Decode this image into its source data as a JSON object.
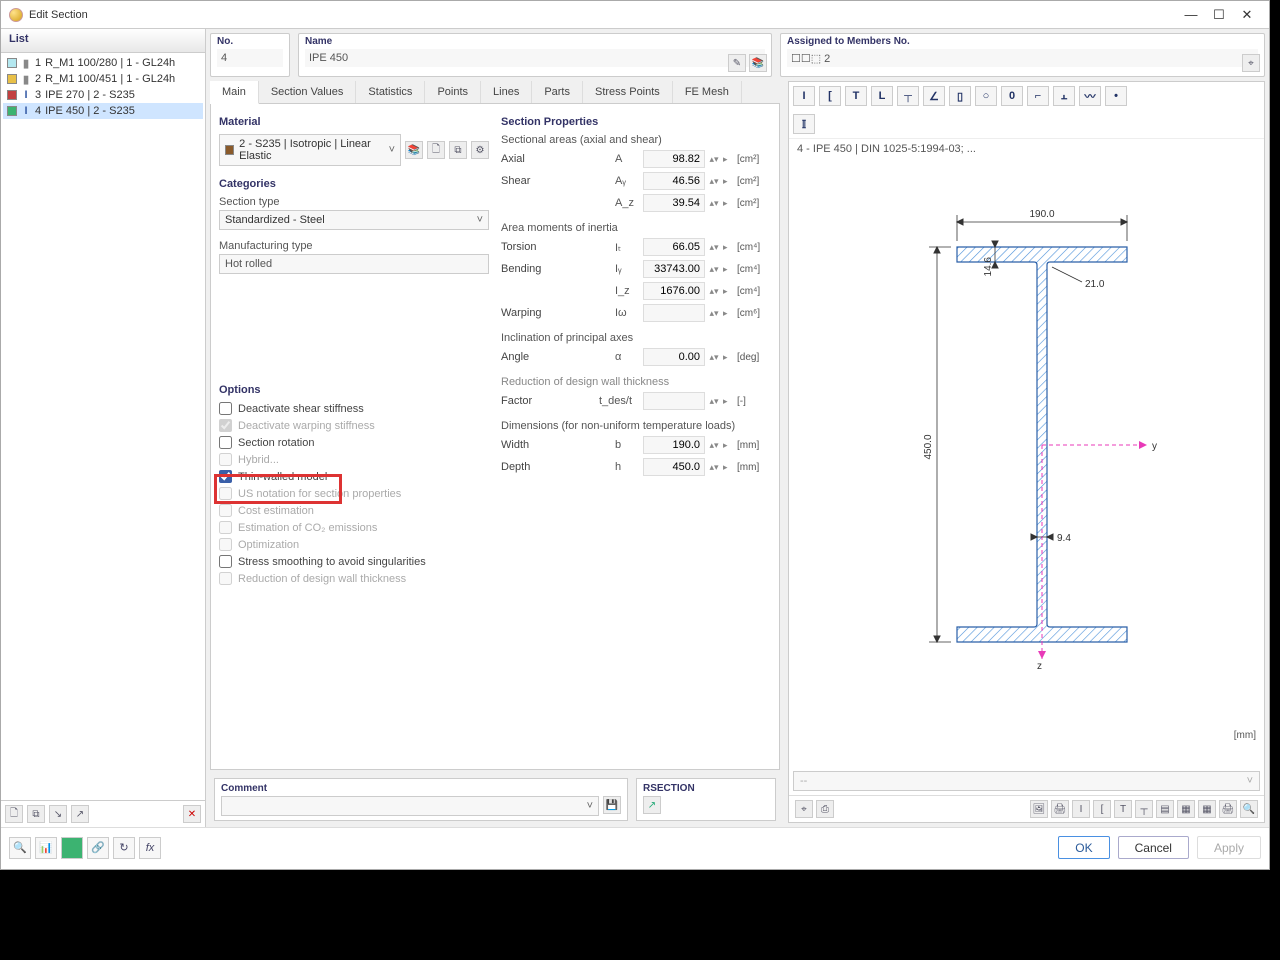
{
  "window_title": "Edit Section",
  "list_header": "List",
  "list_items": [
    {
      "num": "1",
      "text": "R_M1 100/280 | 1 - GL24h",
      "color": "#b4e8f0",
      "shape_color": "#888"
    },
    {
      "num": "2",
      "text": "R_M1 100/451 | 1 - GL24h",
      "color": "#e8c048",
      "shape_color": "#888"
    },
    {
      "num": "3",
      "text": "IPE 270 | 2 - S235",
      "color": "#c24040",
      "shape_color": "#3a5fa8"
    },
    {
      "num": "4",
      "text": "IPE 450 | 2 - S235",
      "color": "#3cb371",
      "shape_color": "#3a5fa8"
    }
  ],
  "no_label": "No.",
  "no_value": "4",
  "name_label": "Name",
  "name_value": "IPE 450",
  "assigned_label": "Assigned to Members No.",
  "assigned_value": "☐☐⬚ 2",
  "tabs": [
    "Main",
    "Section Values",
    "Statistics",
    "Points",
    "Lines",
    "Parts",
    "Stress Points",
    "FE Mesh"
  ],
  "material_header": "Material",
  "material_value": "2 - S235 | Isotropic | Linear Elastic",
  "categories_header": "Categories",
  "section_type_label": "Section type",
  "section_type_value": "Standardized - Steel",
  "manufacturing_label": "Manufacturing type",
  "manufacturing_value": "Hot rolled",
  "options_header": "Options",
  "options": {
    "o1": "Deactivate shear stiffness",
    "o2": "Deactivate warping stiffness",
    "o3": "Section rotation",
    "o4": "Hybrid...",
    "o5": "Thin-walled model",
    "o6": "US notation for section properties",
    "o7": "Cost estimation",
    "o8": "Estimation of CO₂ emissions",
    "o9": "Optimization",
    "o10": "Stress smoothing to avoid singularities",
    "o11": "Reduction of design wall thickness"
  },
  "props_header": "Section Properties",
  "sect_areas": "Sectional areas (axial and shear)",
  "axial": {
    "lbl": "Axial",
    "sym": "A",
    "val": "98.82",
    "unit": "[cm²]"
  },
  "shear_y": {
    "lbl": "Shear",
    "sym": "Aᵧ",
    "val": "46.56",
    "unit": "[cm²]"
  },
  "shear_z": {
    "lbl": "",
    "sym": "A_z",
    "val": "39.54",
    "unit": "[cm²]"
  },
  "inertia_hdr": "Area moments of inertia",
  "torsion": {
    "lbl": "Torsion",
    "sym": "Iₜ",
    "val": "66.05",
    "unit": "[cm⁴]"
  },
  "bending_y": {
    "lbl": "Bending",
    "sym": "Iᵧ",
    "val": "33743.00",
    "unit": "[cm⁴]"
  },
  "bending_z": {
    "lbl": "",
    "sym": "I_z",
    "val": "1676.00",
    "unit": "[cm⁴]"
  },
  "warping": {
    "lbl": "Warping",
    "sym": "Iω",
    "val": "",
    "unit": "[cm⁶]"
  },
  "incl_hdr": "Inclination of principal axes",
  "angle": {
    "lbl": "Angle",
    "sym": "α",
    "val": "0.00",
    "unit": "[deg]"
  },
  "reduc_hdr": "Reduction of design wall thickness",
  "factor": {
    "lbl": "Factor",
    "sym": "t_des/t",
    "val": "",
    "unit": "[-]"
  },
  "dims_hdr": "Dimensions (for non-uniform temperature loads)",
  "width": {
    "lbl": "Width",
    "sym": "b",
    "val": "190.0",
    "unit": "[mm]"
  },
  "depth": {
    "lbl": "Depth",
    "sym": "h",
    "val": "450.0",
    "unit": "[mm]"
  },
  "comment_label": "Comment",
  "rsection_label": "RSECTION",
  "preview_title": "4 - IPE 450 | DIN 1025-5:1994-03; ...",
  "preview_unit": "[mm]",
  "preview_footer_left": "--",
  "dim_width": "190.0",
  "dim_height": "450.0",
  "dim_tf": "14.6",
  "dim_r": "21.0",
  "dim_tw": "9.4",
  "axis_y": "y",
  "axis_z": "z",
  "btn_ok": "OK",
  "btn_cancel": "Cancel",
  "btn_apply": "Apply"
}
